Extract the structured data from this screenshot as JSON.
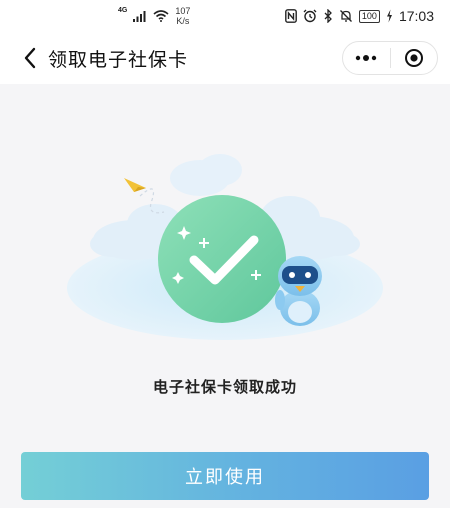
{
  "status_bar": {
    "network_gen": "4G",
    "speed_value": "107",
    "speed_unit": "K/s",
    "battery": "100",
    "time": "17:03",
    "icons": [
      "signal-icon",
      "wifi-icon",
      "nfc-icon",
      "alarm-icon",
      "bluetooth-icon",
      "mute-icon",
      "battery-icon",
      "charging-icon"
    ]
  },
  "nav": {
    "title": "领取电子社保卡",
    "back_icon": "chevron-left-icon",
    "more_icon": "more-dots-icon",
    "close_icon": "target-close-icon"
  },
  "result": {
    "message": "电子社保卡领取成功"
  },
  "action": {
    "button_label": "立即使用"
  },
  "colors": {
    "success_green": "#6fd3a4",
    "button_start": "#74cfd6",
    "button_end": "#5a9fe3",
    "background": "#f5f5f7"
  }
}
